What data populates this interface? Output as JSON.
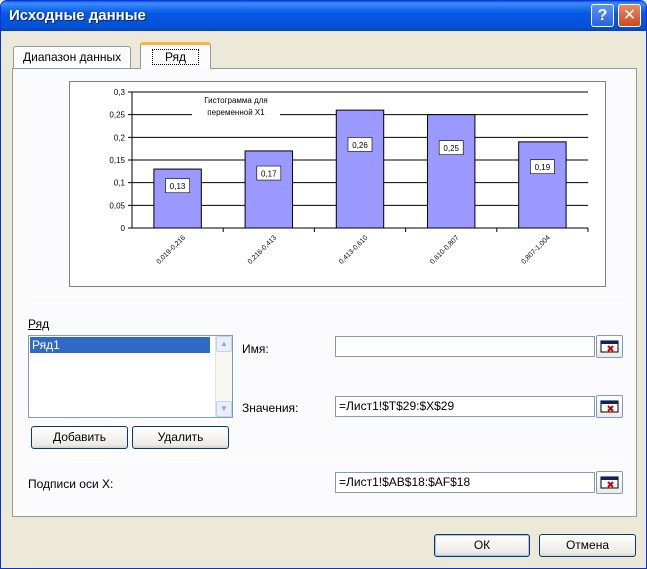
{
  "window": {
    "title": "Исходные данные"
  },
  "tabs": [
    {
      "label": "Диапазон данных",
      "active": false
    },
    {
      "label": "Ряд",
      "active": true
    }
  ],
  "chart_data": {
    "type": "bar",
    "annotation": "Гистограмма для переменной Х1",
    "annotation_lines": [
      "Гистограмма для",
      "переменной Х1"
    ],
    "categories": [
      "0,019-0,216",
      "0,216-0,413",
      "0,413-0,610",
      "0,610-0,807",
      "0,807-1,004"
    ],
    "values": [
      0.13,
      0.17,
      0.26,
      0.25,
      0.19
    ],
    "data_labels": [
      "0,13",
      "0,17",
      "0,26",
      "0,25",
      "0,19"
    ],
    "y_ticks": [
      0,
      0.05,
      0.1,
      0.15,
      0.2,
      0.25,
      0.3
    ],
    "y_tick_labels": [
      "0",
      "0,05",
      "0,1",
      "0,15",
      "0,2",
      "0,25",
      "0,3"
    ],
    "ylim": [
      0,
      0.3
    ],
    "grid": true,
    "bar_color": "#9999ff"
  },
  "series_section": {
    "label": "Ряд",
    "items": [
      "Ряд1"
    ],
    "add_button": "Добавить",
    "delete_button": "Удалить"
  },
  "fields": {
    "name_label": "Имя:",
    "name_value": "",
    "values_label": "Значения:",
    "values_value": "=Лист1!$T$29:$X$29",
    "xlabels_label": "Подписи оси X:",
    "xlabels_value": "=Лист1!$AB$18:$AF$18"
  },
  "buttons": {
    "ok": "ОК",
    "cancel": "Отмена"
  },
  "titlebar_buttons": {
    "help": "?",
    "close": "✕"
  }
}
